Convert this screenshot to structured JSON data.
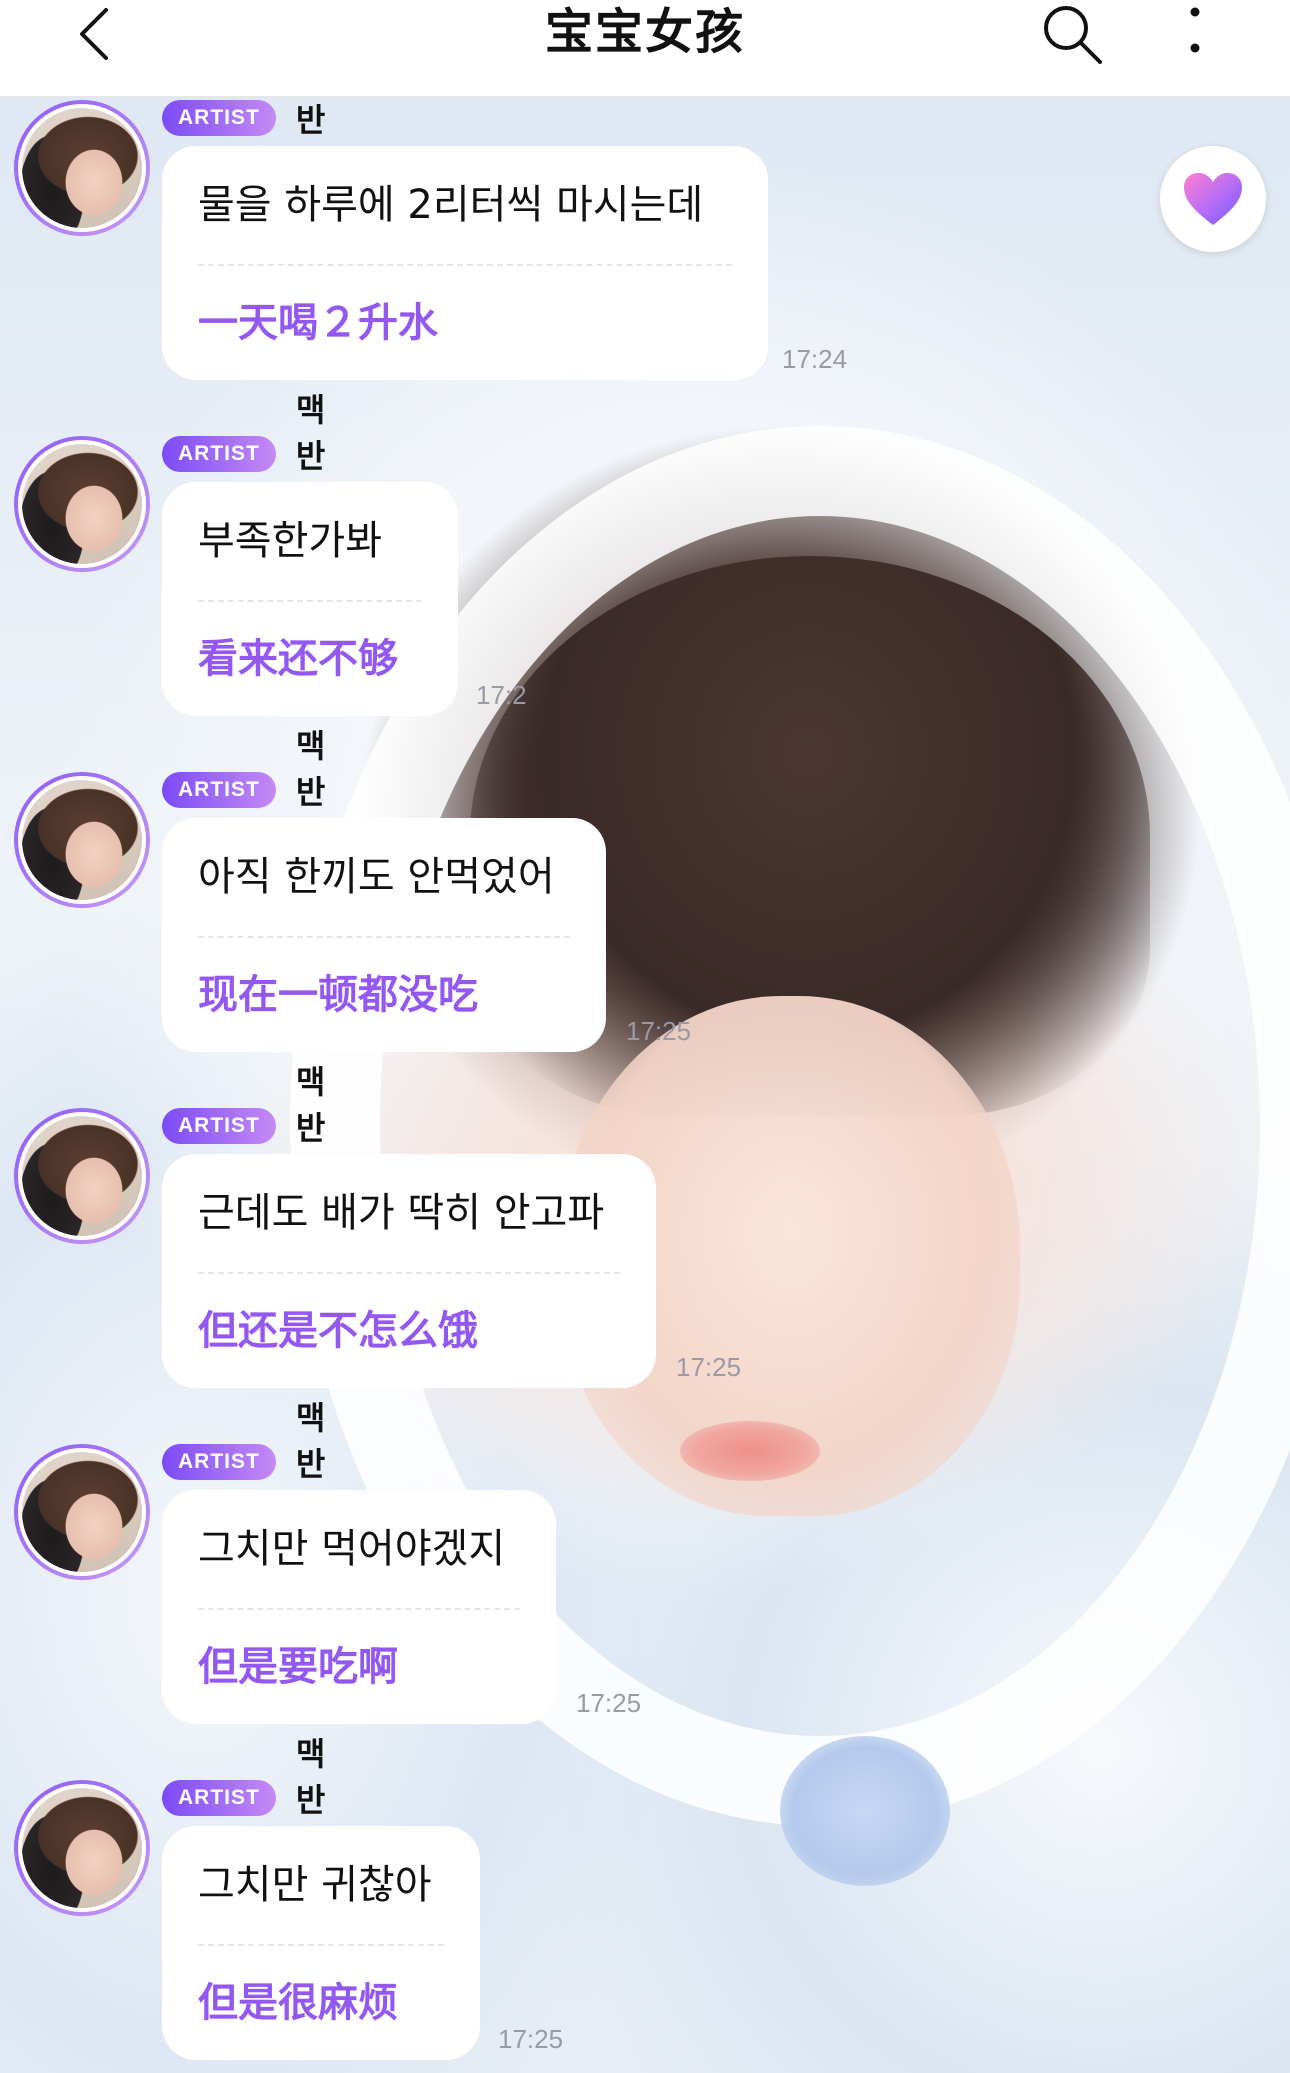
{
  "header": {
    "title": "宝宝女孩",
    "back_icon": "chevron-left-icon",
    "search_icon": "search-icon",
    "more_icon": "more-vertical-icon"
  },
  "heart_button": {
    "icon": "heart-icon"
  },
  "badge_label": "ARTIST",
  "messages": [
    {
      "sender": "맥반석",
      "original": "물을 하루에 2리터씩 마시는데",
      "translation": "一天喝２升水",
      "time": "17:24"
    },
    {
      "sender": "맥반석",
      "original": "부족한가봐",
      "translation": "看来还不够",
      "time": "17:2"
    },
    {
      "sender": "맥반석",
      "original": "아직 한끼도 안먹었어",
      "translation": "现在一顿都没吃",
      "time": "17:25"
    },
    {
      "sender": "맥반석",
      "original": "근데도 배가 딱히 안고파",
      "translation": "但还是不怎么饿",
      "time": "17:25"
    },
    {
      "sender": "맥반석",
      "original": "그치만 먹어야겠지",
      "translation": "但是要吃啊",
      "time": "17:25"
    },
    {
      "sender": "맥반석",
      "original": "그치만 귀찮아",
      "translation": "但是很麻烦",
      "time": "17:25"
    }
  ],
  "colors": {
    "accent": "#9258f0",
    "badge_start": "#7b4cf5",
    "badge_end": "#c58af5",
    "time_text": "#9a9aa6"
  }
}
